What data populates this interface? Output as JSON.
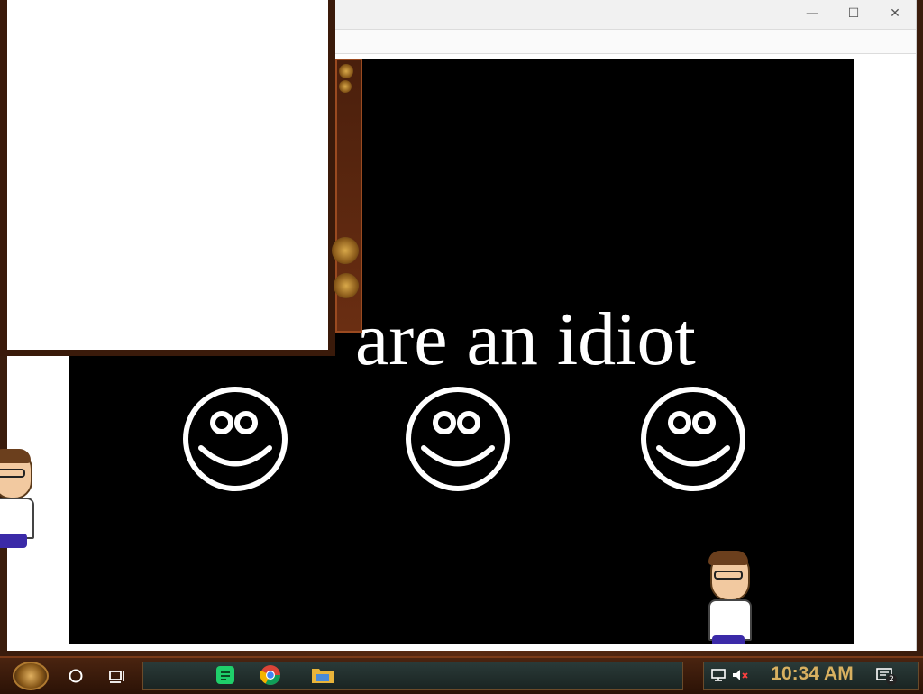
{
  "browser": {
    "headline": "are an idiot",
    "controls": {
      "minimize": "—",
      "maximize": "☐",
      "close": "✕"
    }
  },
  "taskbar": {
    "clock": "10:34 AM",
    "notification_count": "2",
    "icons": [
      "start-orb",
      "cortana-circle-icon",
      "task-view-icon",
      "notes-app-icon",
      "chrome-icon",
      "file-explorer-icon",
      "network-icon",
      "volume-muted-icon",
      "action-center-icon"
    ]
  },
  "colors": {
    "page_background": "#000000",
    "headline_text": "#ffffff",
    "clock_text": "#d8b060"
  }
}
